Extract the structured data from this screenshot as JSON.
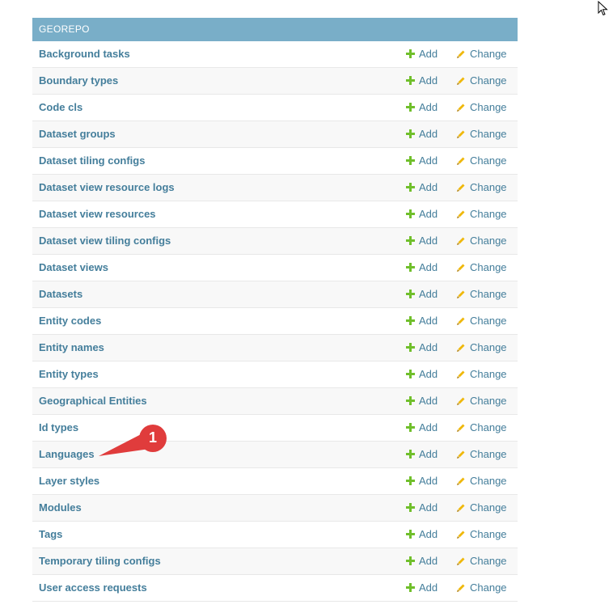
{
  "module": {
    "title": "GEOREPO"
  },
  "actions": {
    "add_label": "Add",
    "change_label": "Change"
  },
  "models": [
    "Background tasks",
    "Boundary types",
    "Code cls",
    "Dataset groups",
    "Dataset tiling configs",
    "Dataset view resource logs",
    "Dataset view resources",
    "Dataset view tiling configs",
    "Dataset views",
    "Datasets",
    "Entity codes",
    "Entity names",
    "Entity types",
    "Geographical Entities",
    "Id types",
    "Languages",
    "Layer styles",
    "Modules",
    "Tags",
    "Temporary tiling configs",
    "User access requests"
  ],
  "annotation": {
    "number": "1",
    "target": "Languages",
    "color": "#e03c3c"
  },
  "colors": {
    "header_bg": "#79aec8",
    "link": "#447e9b",
    "add_icon": "#70bf2b",
    "change_icon": "#efb80b"
  }
}
